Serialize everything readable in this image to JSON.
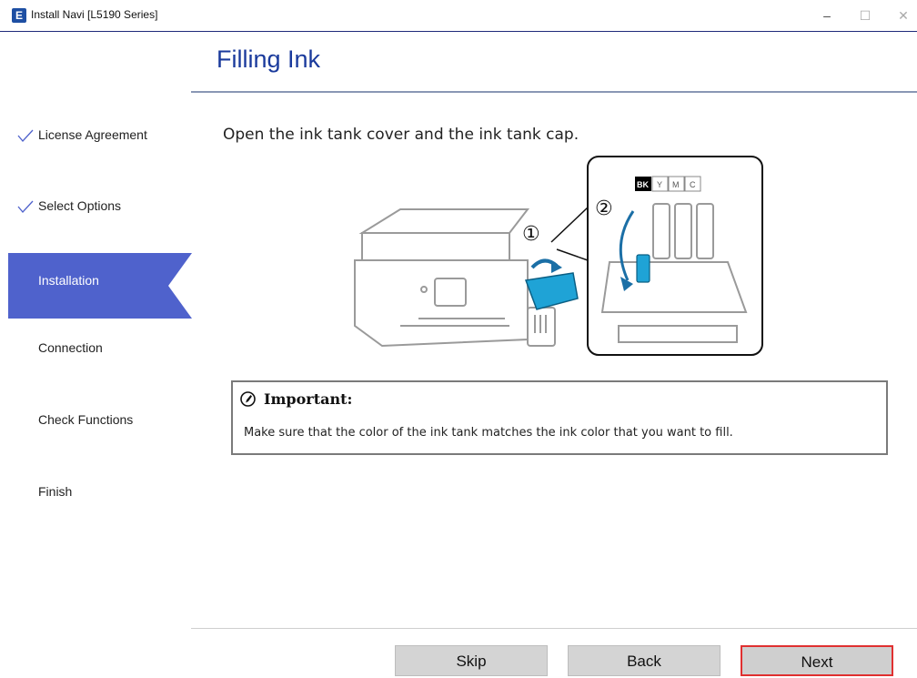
{
  "window": {
    "icon_letter": "E",
    "title": "Install Navi [L5190 Series]",
    "controls": {
      "minimize": "–",
      "maximize": "☐",
      "close": "✕"
    }
  },
  "page": {
    "title": "Filling Ink"
  },
  "sidebar": {
    "steps": [
      {
        "label": "License Agreement",
        "state": "done"
      },
      {
        "label": "Select Options",
        "state": "done"
      },
      {
        "label": "Installation",
        "state": "current"
      },
      {
        "label": "Connection",
        "state": "pending"
      },
      {
        "label": "Check Functions",
        "state": "pending"
      },
      {
        "label": "Finish",
        "state": "pending"
      }
    ]
  },
  "content": {
    "instruction": "Open the ink tank cover and the ink tank cap.",
    "illustration": {
      "step1_marker": "①",
      "step2_marker": "②",
      "tank_labels": [
        "BK",
        "Y",
        "M",
        "C"
      ]
    },
    "important": {
      "title": "Important:",
      "body": "Make sure that the color of the ink tank matches the ink color that you want to fill."
    }
  },
  "footer": {
    "skip_label": "Skip",
    "back_label": "Back",
    "next_label": "Next"
  },
  "colors": {
    "accent": "#4f62cc",
    "title": "#1a3a9c",
    "next_highlight": "#e03030",
    "ink_blue": "#1fa3d6"
  }
}
